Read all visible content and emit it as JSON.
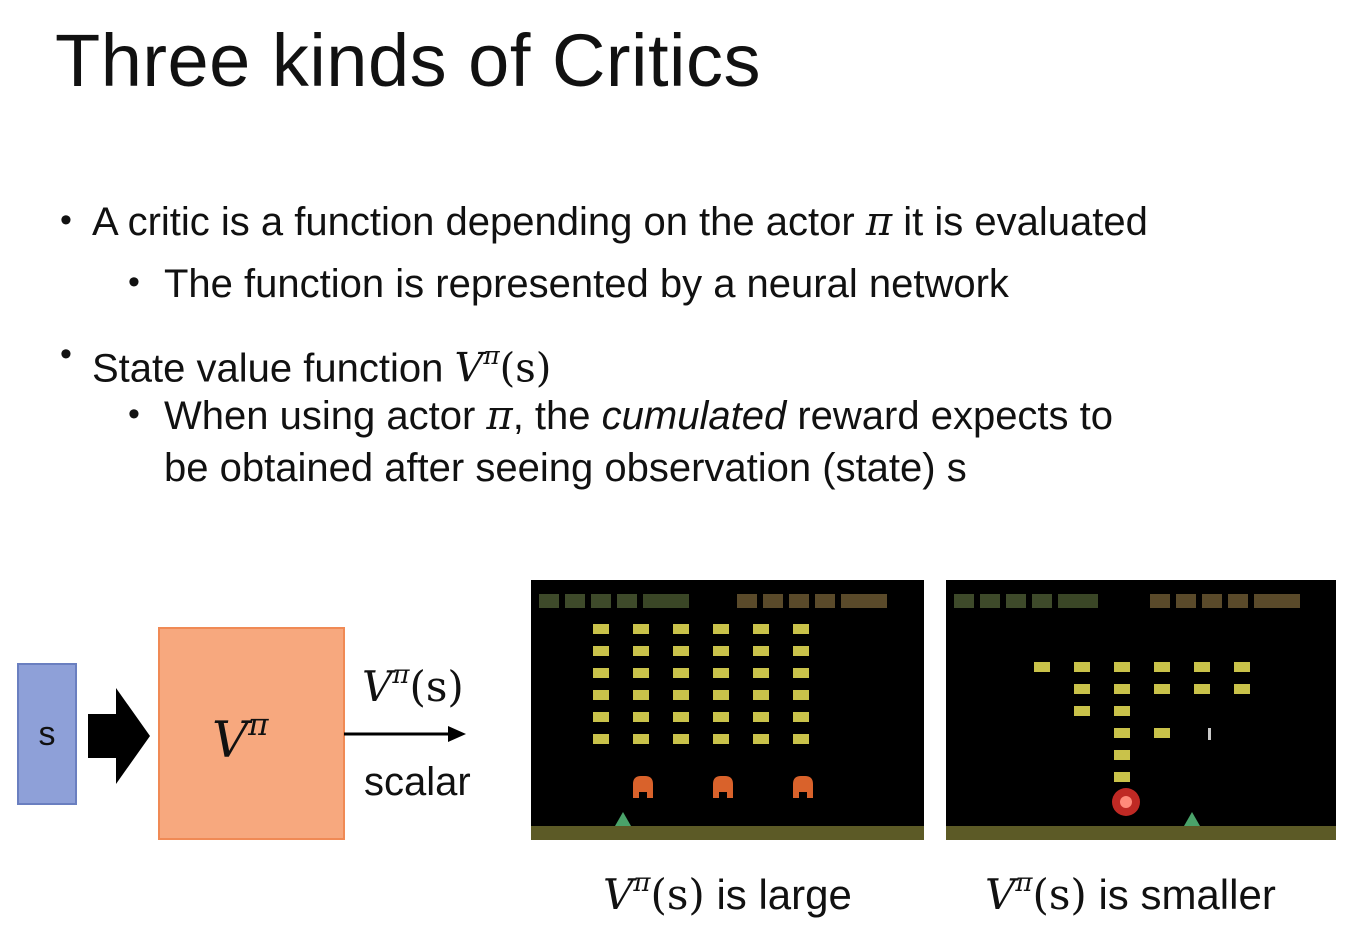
{
  "title": "Three kinds of Critics",
  "bullets": {
    "b1": {
      "pre": "A critic is a function depending on the actor ",
      "pi": "π",
      "post": " it is evaluated"
    },
    "b1a": "The function is represented by a neural network",
    "b2": {
      "pre": "State value function ",
      "V": "V",
      "sup": "π",
      "arg": "(s)"
    },
    "b2a": {
      "pre": "When using actor ",
      "pi": "π",
      "mid": ", the ",
      "em": "cumulated",
      "post": " reward expects to",
      "line2": "be obtained after seeing observation (state) s"
    }
  },
  "diagram": {
    "input_label": "s",
    "network_V": "V",
    "network_sup": "π",
    "output_V": "V",
    "output_sup": "π",
    "output_arg": "(s)",
    "output_type": "scalar"
  },
  "captions": {
    "left": {
      "V": "V",
      "sup": "π",
      "arg": "(s)",
      "text": " is large"
    },
    "right": {
      "V": "V",
      "sup": "π",
      "arg": "(s)",
      "text": " is smaller"
    }
  },
  "colors": {
    "input_box": "#8ea0d8",
    "network_box": "#f7a87e",
    "invader": "#c9c24a",
    "bunker": "#d9622b",
    "ground": "#5c5a26"
  }
}
